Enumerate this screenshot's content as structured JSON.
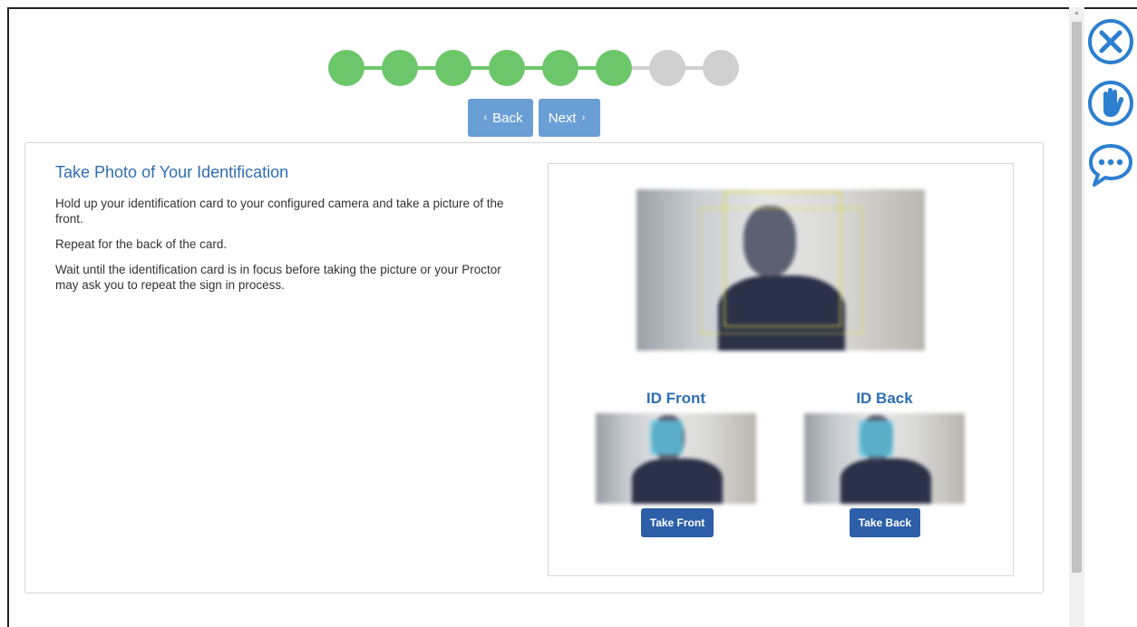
{
  "progress": {
    "total_steps": 8,
    "completed_steps": 6,
    "colors": {
      "done": "#6cc76a",
      "todo": "#d0d0d0"
    }
  },
  "nav": {
    "back_label": "Back",
    "next_label": "Next",
    "back_chevron": "‹",
    "next_chevron": "›"
  },
  "content": {
    "title": "Take Photo of Your Identification",
    "paragraphs": [
      "Hold up your identification card to your configured camera and take a picture of the front.",
      "Repeat for the back of the card.",
      "Wait until the identification card is in focus before taking the picture or your Proctor may ask you to repeat the sign in process."
    ]
  },
  "camera": {
    "front_label": "ID Front",
    "back_label": "ID Back",
    "take_front_label": "Take Front",
    "take_back_label": "Take Back"
  },
  "side_icons": [
    "close-icon",
    "raise-hand-icon",
    "chat-icon"
  ],
  "colors": {
    "accent": "#2f6eb3",
    "button": "#2d5fa8",
    "nav_button": "#6a9fd6"
  }
}
